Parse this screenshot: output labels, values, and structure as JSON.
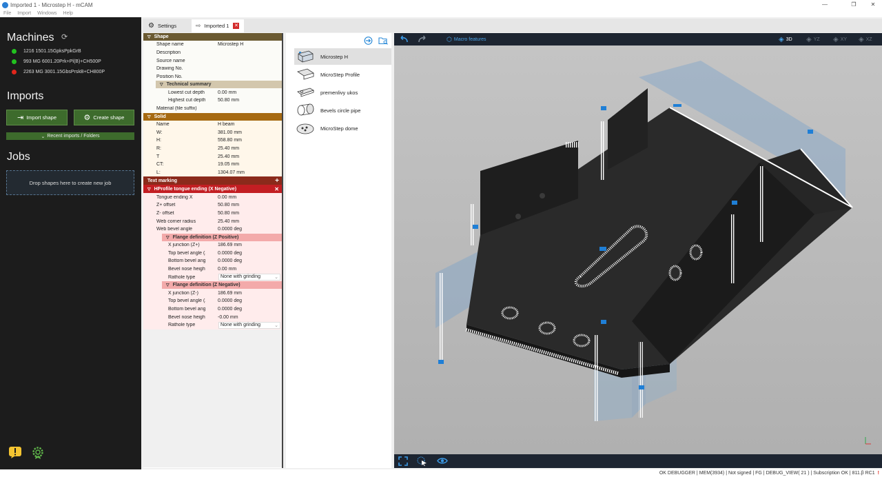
{
  "window": {
    "title": "Imported 1 - Microstep H - mCAM",
    "controls": [
      "—",
      "❐",
      "✕"
    ]
  },
  "menu": [
    "File",
    "Import",
    "Windows",
    "Help"
  ],
  "sidebar": {
    "machines_title": "Machines",
    "machines": [
      {
        "label": "1216 1501.15GpksPpkGrB",
        "status_color": "#22c11f"
      },
      {
        "label": "993 MG 6001.20Prk+Pl(B)+CH500P",
        "status_color": "#22c11f"
      },
      {
        "label": "2263 MG  3001.15GbsPrskB+CH800P",
        "status_color": "#e0261b"
      }
    ],
    "imports_title": "Imports",
    "import_shape": "Import shape",
    "create_shape": "Create shape",
    "recent_imports": "Recent imports / Folders",
    "jobs_title": "Jobs",
    "drop_text": "Drop shapes here to create new job"
  },
  "tabs": [
    {
      "label": "Settings",
      "icon": "gear-icon"
    },
    {
      "label": "Imported 1",
      "icon": "import-arrow-icon",
      "close": "✕"
    }
  ],
  "props": {
    "shape": {
      "title": "Shape",
      "rows": [
        {
          "k": "Shape name",
          "v": "Microstep H"
        },
        {
          "k": "Description",
          "v": ""
        },
        {
          "k": "Source name",
          "v": ""
        },
        {
          "k": "Drawing No.",
          "v": ""
        },
        {
          "k": "Position No.",
          "v": ""
        }
      ],
      "tech_title": "Technical summary",
      "tech_rows": [
        {
          "k": "Lowest cut depth",
          "v": "0.00 mm"
        },
        {
          "k": "Highest cut depth",
          "v": "50.80 mm"
        }
      ],
      "material": {
        "k": "Material (file suffix)",
        "v": ""
      }
    },
    "solid": {
      "title": "Solid",
      "rows": [
        {
          "k": "Name",
          "v": "H beam"
        },
        {
          "k": "W:",
          "v": "381.00 mm"
        },
        {
          "k": "H:",
          "v": "558.80 mm"
        },
        {
          "k": "R:",
          "v": "25.40 mm"
        },
        {
          "k": "T",
          "v": "25.40 mm"
        },
        {
          "k": "CT:",
          "v": "19.05 mm"
        },
        {
          "k": "L:",
          "v": "1304.07 mm"
        }
      ]
    },
    "text_marking": {
      "title": "Text marking",
      "add": "+"
    },
    "hprofile": {
      "title": "HProfile tongue ending (X Negative)",
      "close": "✕",
      "rows": [
        {
          "k": "Tongue ending X",
          "v": "0.00 mm"
        },
        {
          "k": "Z+ offset",
          "v": "50.80 mm"
        },
        {
          "k": "Z- offset",
          "v": "50.80 mm"
        },
        {
          "k": "Web corner radius",
          "v": "25.40 mm"
        },
        {
          "k": "Web bevel angle",
          "v": "0.0000 deg"
        }
      ],
      "flange_pos_title": "Flange definition (Z Positive)",
      "flange_pos": [
        {
          "k": "X junction (Z+)",
          "v": "186.69 mm"
        },
        {
          "k": "Top bevel angle (Z+",
          "v": "0.0000 deg"
        },
        {
          "k": "Bottom bevel angle",
          "v": "0.0000 deg"
        },
        {
          "k": "Bevel nose height (",
          "v": "0.00 mm"
        },
        {
          "k": "Rathole type",
          "v": "None with grinding"
        }
      ],
      "flange_neg_title": "Flange definition (Z Negative)",
      "flange_neg": [
        {
          "k": "X junction (Z-)",
          "v": "186.69 mm"
        },
        {
          "k": "Top bevel angle (Z-)",
          "v": "0.0000 deg"
        },
        {
          "k": "Bottom bevel angle",
          "v": "0.0000 deg"
        },
        {
          "k": "Bevel nose height (",
          "v": "-0.00 mm"
        },
        {
          "k": "Rathole type",
          "v": "None with grinding"
        }
      ]
    }
  },
  "library": {
    "items": [
      "Microstep H",
      "MicroStep Profile",
      "premenlivy ukos",
      "Bevels circle pipe",
      "MicroStep dome"
    ],
    "selected_index": 0
  },
  "viewport": {
    "macro": "Macro features",
    "views": [
      "3D",
      "YZ",
      "XY",
      "XZ"
    ],
    "active_view": "3D"
  },
  "status": "OK    DEBUGGER | MEM(3934) | Not signed | FG | DEBUG_VIEW( 21 ) | Subscription OK | 811.β RC1"
}
